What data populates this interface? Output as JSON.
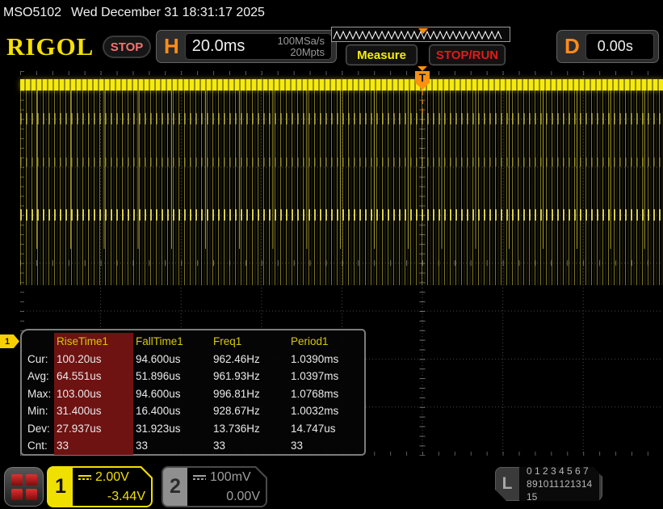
{
  "topbar": {
    "model": "MSO5102",
    "datetime": "Wed December 31 18:31:17 2025"
  },
  "header": {
    "brand": "RIGOL",
    "status": "STOP",
    "horizontal": {
      "label": "H",
      "timebase": "20.0ms",
      "sample_rate": "100MSa/s",
      "mem_depth": "20Mpts"
    },
    "measure_label": "Measure",
    "stop_run_label": "STOP/RUN",
    "delay": {
      "label": "D",
      "value": "0.00s"
    }
  },
  "trigger": {
    "marker": "T"
  },
  "measurements": {
    "columns": [
      "RiseTime1",
      "FallTime1",
      "Freq1",
      "Period1"
    ],
    "selected_column": "RiseTime1",
    "rows": [
      {
        "label": "Cur:",
        "values": [
          "100.20us",
          "94.600us",
          "962.46Hz",
          "1.0390ms"
        ]
      },
      {
        "label": "Avg:",
        "values": [
          "64.551us",
          "51.896us",
          "961.93Hz",
          "1.0397ms"
        ]
      },
      {
        "label": "Max:",
        "values": [
          "103.00us",
          "94.600us",
          "996.81Hz",
          "1.0768ms"
        ]
      },
      {
        "label": "Min:",
        "values": [
          "31.400us",
          "16.400us",
          "928.67Hz",
          "1.0032ms"
        ]
      },
      {
        "label": "Dev:",
        "values": [
          "27.937us",
          "31.923us",
          "13.736Hz",
          "14.747us"
        ]
      },
      {
        "label": "Cnt:",
        "values": [
          "33",
          "33",
          "33",
          "33"
        ]
      }
    ]
  },
  "channels": {
    "ch1": {
      "number": "1",
      "scale": "2.00V",
      "offset": "-3.44V"
    },
    "ch2": {
      "number": "2",
      "scale": "100mV",
      "offset": "0.00V"
    },
    "logic": {
      "label": "L",
      "row1": "0 1 2 3  4 5 6 7",
      "row2": "8 9 10 11 12 13 14 15"
    }
  },
  "colors": {
    "waveform_yellow": "#f0e500",
    "channel1_yellow": "#f0e000",
    "channel2_gray": "#9f9f9f",
    "trigger_orange": "#ff8c00",
    "status_stop_red": "#ff6e6e",
    "stop_run_red": "#e81818",
    "measure_yellow": "#f6ef00",
    "selected_column_bg": "#6e1212"
  }
}
